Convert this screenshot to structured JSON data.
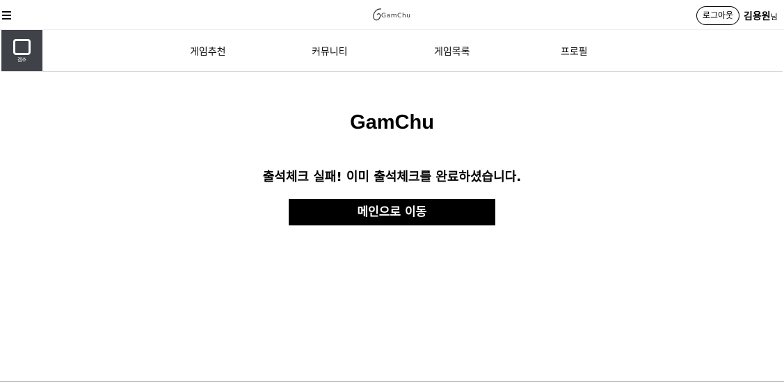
{
  "header": {
    "menu_icon": "hamburger-icon",
    "logo_text": "GamChu",
    "logout_label": "로그아웃",
    "user_name": "김용원",
    "user_suffix": "님"
  },
  "nav": {
    "logo_icon": "square-logo-icon",
    "logo_label": "겜추",
    "logo_bg_color": "#3f4248",
    "items": [
      {
        "label": "게임추천"
      },
      {
        "label": "커뮤니티"
      },
      {
        "label": "게임목록"
      },
      {
        "label": "프로필"
      }
    ]
  },
  "main": {
    "title": "GamChu",
    "message": "출석체크 실패! 이미 출석체크를 완료하셨습니다.",
    "button_label": "메인으로 이동",
    "button_color": "#000000"
  }
}
